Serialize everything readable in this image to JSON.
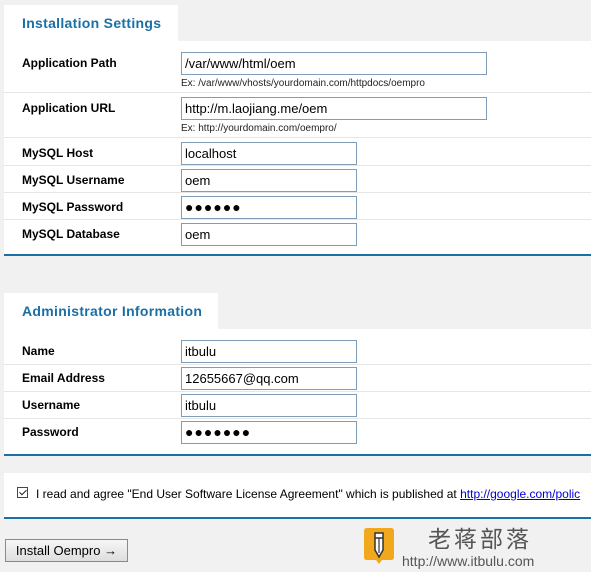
{
  "installation": {
    "title": "Installation Settings",
    "fields": [
      {
        "label": "Application Path",
        "value": "/var/www/html/oem",
        "hint": "Ex: /var/www/vhosts/yourdomain.com/httpdocs/oempro"
      },
      {
        "label": "Application URL",
        "value": "http://m.laojiang.me/oem",
        "hint": "Ex: http://yourdomain.com/oempro/"
      },
      {
        "label": "MySQL Host",
        "value": "localhost"
      },
      {
        "label": "MySQL Username",
        "value": "oem"
      },
      {
        "label": "MySQL Password",
        "value": "●●●●●●"
      },
      {
        "label": "MySQL Database",
        "value": "oem"
      }
    ]
  },
  "administrator": {
    "title": "Administrator Information",
    "fields": [
      {
        "label": "Name",
        "value": "itbulu"
      },
      {
        "label": "Email Address",
        "value": "12655667@qq.com"
      },
      {
        "label": "Username",
        "value": "itbulu"
      },
      {
        "label": "Password",
        "value": "●●●●●●●"
      }
    ]
  },
  "agreement": {
    "checked": true,
    "text": "I read and agree \"End User Software License Agreement\" which is published at ",
    "link": "http://google.com/polic"
  },
  "install_button": {
    "label": "Install Oempro →"
  },
  "watermark": {
    "chinese": "老蒋部落",
    "url": "http://www.itbulu.com"
  },
  "colors": {
    "accent": "#1a6fa6",
    "background": "#f1f1f1",
    "input_border": "#7f9db9",
    "link": "#0000cc"
  }
}
